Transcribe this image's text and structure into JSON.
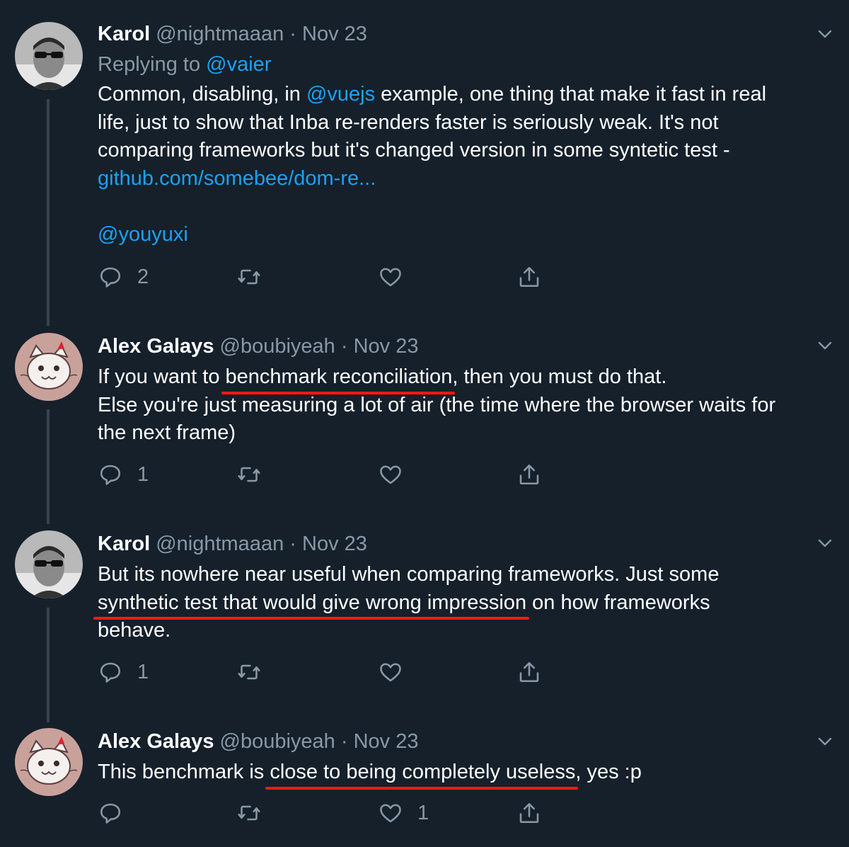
{
  "tweets": [
    {
      "name": "Karol",
      "handle": "@nightmaaan",
      "dot": "·",
      "date": "Nov 23",
      "replying_prefix": "Replying to ",
      "replying_to": "@vaier",
      "line1_a": "Common, disabling, in ",
      "line1_mention": "@vuejs",
      "line1_b": " example, one thing that make it fast in real",
      "line2": "life, just to show that Inba re-renders faster is seriously weak. It's not",
      "line3": "comparing frameworks but it's changed version in some syntetic test -",
      "line4_link": "github.com/somebee/dom-re...",
      "line6_mention": "@youyuxi",
      "reply_count": "2",
      "retweet_count": "",
      "like_count": ""
    },
    {
      "name": "Alex Galays",
      "handle": "@boubiyeah",
      "dot": "·",
      "date": "Nov 23",
      "line1_a": "If you want to ",
      "line1_hl": "benchmark reconciliation",
      "line1_b": ", then you must do that.",
      "line2": "Else you're just measuring a lot of air (the time where the browser waits for",
      "line3": "the next frame)",
      "reply_count": "1",
      "retweet_count": "",
      "like_count": ""
    },
    {
      "name": "Karol",
      "handle": "@nightmaaan",
      "dot": "·",
      "date": "Nov 23",
      "line1": "But its nowhere near useful when comparing frameworks. Just some",
      "line2_hl": "synthetic test that would give wrong impression",
      "line2_b": " on how frameworks",
      "line3": "behave.",
      "reply_count": "1",
      "retweet_count": "",
      "like_count": ""
    },
    {
      "name": "Alex Galays",
      "handle": "@boubiyeah",
      "dot": "·",
      "date": "Nov 23",
      "line1_a": "This benchmark is ",
      "line1_hl": "close to being completely useless",
      "line1_b": ", yes :p",
      "reply_count": "",
      "retweet_count": "",
      "like_count": "1"
    }
  ],
  "icons": {
    "reply": "reply-icon",
    "retweet": "retweet-icon",
    "like": "heart-icon",
    "share": "share-icon",
    "menu": "chevron-down-icon"
  },
  "colors": {
    "background": "#15202b",
    "muted": "#8899a6",
    "link": "#1da1f2",
    "highlight": "#ff1a0c",
    "thread_line": "#38444d"
  }
}
